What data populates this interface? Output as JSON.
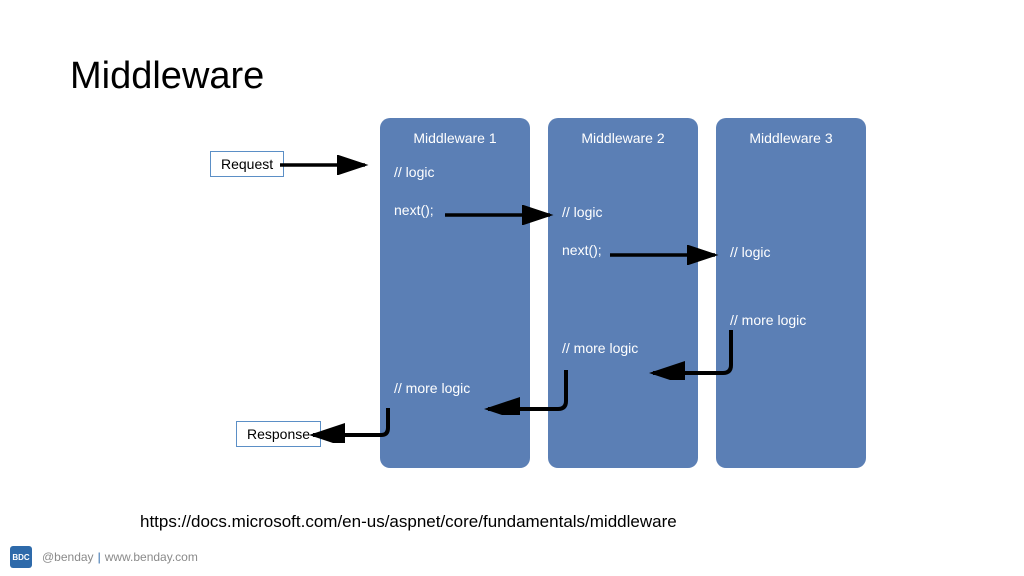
{
  "title": "Middleware",
  "io": {
    "request": "Request",
    "response": "Response"
  },
  "mw": [
    {
      "title": "Middleware 1",
      "pre1": "// logic",
      "call": "next();",
      "post": "// more logic"
    },
    {
      "title": "Middleware 2",
      "pre1": "// logic",
      "call": "next();",
      "post": "// more logic"
    },
    {
      "title": "Middleware 3",
      "pre1": "// logic",
      "post": "// more logic"
    }
  ],
  "url": "https://docs.microsoft.com/en-us/aspnet/core/fundamentals/middleware",
  "footer": {
    "logo": "BDC",
    "handle": "@benday",
    "site": "www.benday.com"
  }
}
